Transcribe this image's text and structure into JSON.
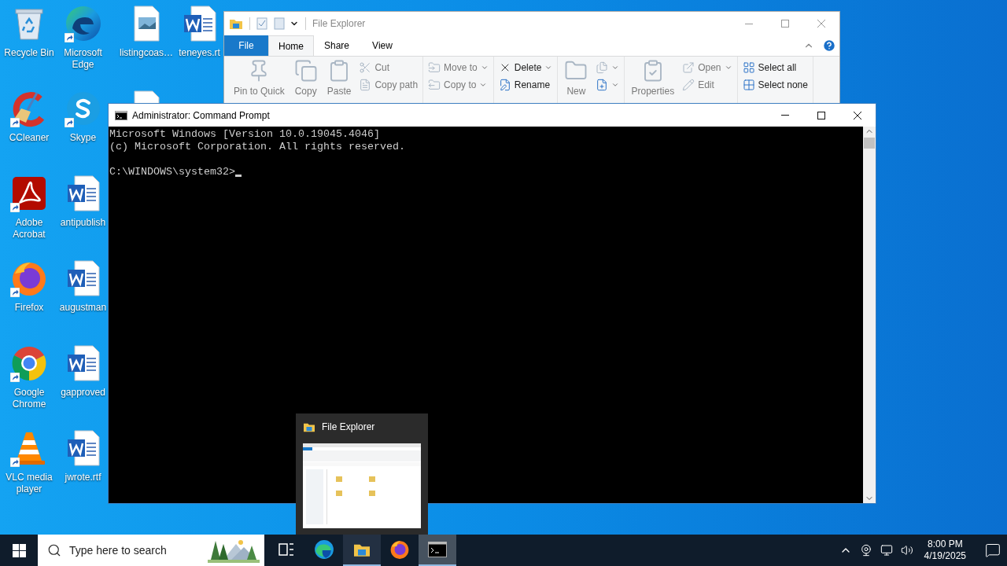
{
  "desktop": {
    "columns": [
      [
        {
          "label": "Recycle Bin",
          "kind": "recycle-bin",
          "shortcut": false
        },
        {
          "label": "CCleaner",
          "kind": "ccleaner",
          "shortcut": true
        },
        {
          "label": "Adobe Acrobat",
          "kind": "acrobat",
          "shortcut": true
        },
        {
          "label": "Firefox",
          "kind": "firefox",
          "shortcut": true
        },
        {
          "label": "Google Chrome",
          "kind": "chrome",
          "shortcut": true
        },
        {
          "label": "VLC media player",
          "kind": "vlc",
          "shortcut": true
        }
      ],
      [
        {
          "label": "Microsoft Edge",
          "kind": "edge",
          "shortcut": true
        },
        {
          "label": "Skype",
          "kind": "skype",
          "shortcut": true
        },
        {
          "label": "antipublish",
          "kind": "word",
          "shortcut": false
        },
        {
          "label": "augustman",
          "kind": "word",
          "shortcut": false
        },
        {
          "label": "gapproved",
          "kind": "word",
          "shortcut": false
        },
        {
          "label": "jwrote.rtf",
          "kind": "word",
          "shortcut": false
        }
      ],
      [
        {
          "label": "listingcoas…",
          "kind": "image-file",
          "shortcut": false
        },
        {
          "kind": "blank-file",
          "shortcut": false
        }
      ],
      [
        {
          "label": "teneyes.rt",
          "kind": "word",
          "shortcut": false
        }
      ]
    ]
  },
  "explorer": {
    "title": "File Explorer",
    "tabs": [
      {
        "label": "File",
        "kind": "menu",
        "selected": false
      },
      {
        "label": "Home",
        "kind": "tab",
        "selected": true
      },
      {
        "label": "Share",
        "kind": "tab",
        "selected": false
      },
      {
        "label": "View",
        "kind": "tab",
        "selected": false
      }
    ],
    "groups": [
      {
        "columns": [
          {
            "kind": "large",
            "items": [
              {
                "label": "Pin to Quick",
                "disabled": true,
                "dropdown": false
              }
            ]
          },
          {
            "kind": "large",
            "items": [
              {
                "label": "Copy",
                "disabled": true,
                "dropdown": false
              }
            ]
          },
          {
            "kind": "large",
            "items": [
              {
                "label": "Paste",
                "disabled": true,
                "dropdown": false
              }
            ]
          },
          {
            "kind": "small",
            "items": [
              {
                "label": "Cut",
                "disabled": true,
                "dropdown": false
              },
              {
                "label": "Copy path",
                "disabled": true,
                "dropdown": false
              }
            ]
          }
        ]
      },
      {
        "columns": [
          {
            "kind": "small",
            "items": [
              {
                "label": "Move to",
                "disabled": true,
                "dropdown": true
              },
              {
                "label": "Copy to",
                "disabled": true,
                "dropdown": true
              }
            ]
          }
        ]
      },
      {
        "columns": [
          {
            "kind": "small",
            "items": [
              {
                "label": "Delete",
                "disabled": false,
                "dropdown": true
              },
              {
                "label": "Rename",
                "disabled": false,
                "dropdown": false
              }
            ]
          }
        ]
      },
      {
        "columns": [
          {
            "kind": "large",
            "items": [
              {
                "label": "New",
                "disabled": true,
                "dropdown": false
              }
            ]
          },
          {
            "kind": "small",
            "items": [
              {
                "disabled": true,
                "dropdown": true
              },
              {
                "disabled": false,
                "dropdown": true
              }
            ]
          }
        ]
      },
      {
        "columns": [
          {
            "kind": "large",
            "items": [
              {
                "label": "Properties",
                "disabled": true,
                "dropdown": false
              }
            ]
          },
          {
            "kind": "small",
            "items": [
              {
                "label": "Open",
                "disabled": true,
                "dropdown": true
              },
              {
                "label": "Edit",
                "disabled": true,
                "dropdown": false
              }
            ]
          }
        ]
      },
      {
        "columns": [
          {
            "kind": "small",
            "items": [
              {
                "label": "Select all",
                "disabled": false,
                "dropdown": false
              },
              {
                "label": "Select none",
                "disabled": false,
                "dropdown": false
              }
            ]
          }
        ]
      }
    ]
  },
  "cmd": {
    "title": "Administrator: Command Prompt",
    "lines": [
      "Microsoft Windows [Version 10.0.19045.4046]",
      "(c) Microsoft Corporation. All rights reserved."
    ],
    "prompt": "C:\\WINDOWS\\system32>"
  },
  "preview": {
    "title": "File Explorer"
  },
  "taskbar": {
    "search_placeholder": "Type here to search",
    "apps": [
      {
        "kind": "task-view",
        "open": false,
        "selected": false,
        "hovered": false
      },
      {
        "kind": "edge",
        "open": false,
        "selected": false,
        "hovered": false
      },
      {
        "kind": "explorer",
        "open": true,
        "selected": false,
        "hovered": true
      },
      {
        "kind": "firefox",
        "open": false,
        "selected": false,
        "hovered": false
      },
      {
        "kind": "cmd",
        "open": true,
        "selected": true,
        "hovered": false
      }
    ],
    "clock": {
      "time": "8:00 PM",
      "date": "4/19/2025"
    }
  }
}
